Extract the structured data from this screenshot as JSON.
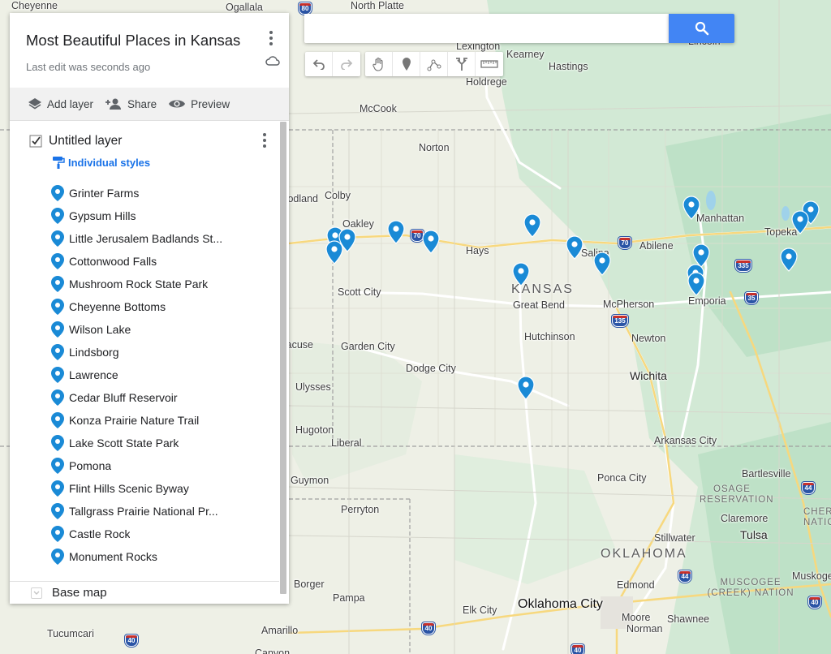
{
  "map_name": "Most Beautiful Places in Kansas",
  "edit_status": "Last edit was seconds ago",
  "actions": {
    "add_layer": "Add layer",
    "share": "Share",
    "preview": "Preview"
  },
  "layer": {
    "name": "Untitled layer",
    "checked": true,
    "style_label": "Individual styles",
    "places": [
      "Grinter Farms",
      "Gypsum Hills",
      "Little Jerusalem Badlands St...",
      "Cottonwood Falls",
      "Mushroom Rock State Park",
      "Cheyenne Bottoms",
      "Wilson Lake",
      "Lindsborg",
      "Lawrence",
      "Cedar Bluff Reservoir",
      "Konza Prairie Nature Trail",
      "Lake Scott State Park",
      "Pomona",
      "Flint Hills Scenic Byway",
      "Tallgrass Prairie National Pr...",
      "Castle Rock",
      "Monument Rocks"
    ]
  },
  "base_map_label": "Base map",
  "search": {
    "value": "",
    "placeholder": ""
  },
  "toolbar_icons": [
    "undo-icon",
    "redo-icon",
    "hand-icon",
    "marker-icon",
    "line-icon",
    "directions-icon",
    "ruler-icon"
  ],
  "colors": {
    "pin": "#1a8ad6",
    "accent": "#4285f4",
    "link": "#1a73e8"
  },
  "map_labels": {
    "cities": [
      "Cheyenne",
      "Ogallala",
      "North Platte",
      "Lexington",
      "Kearney",
      "Hastings",
      "Holdrege",
      "Lincoln",
      "McCook",
      "Norton",
      "Colby",
      "Oakley",
      "Hays",
      "Salina",
      "Abilene",
      "Manhattan",
      "Topeka",
      "Scott City",
      "Great Bend",
      "McPherson",
      "Emporia",
      "Garden City",
      "Hutchinson",
      "Newton",
      "Dodge City",
      "Wichita",
      "Ulysses",
      "Hugoton",
      "Liberal",
      "Arkansas City",
      "Guymon",
      "Ponca City",
      "Bartlesville",
      "Perryton",
      "Stillwater",
      "Claremore",
      "Tulsa",
      "Muskogee",
      "Edmond",
      "Borger",
      "Pampa",
      "Elk City",
      "Oklahoma City",
      "Moore",
      "Norman",
      "Shawnee",
      "Tucumcari",
      "Amarillo",
      "Canyon",
      "Goodland",
      "Syracuse"
    ],
    "states": [
      "KANSAS",
      "OKLAHOMA"
    ],
    "regions": [
      "OSAGE RESERVATION",
      "MUSCOGEE (CREEK) NATION",
      "CHEROKEE NATION"
    ],
    "highways": [
      "80",
      "70",
      "70",
      "335",
      "35",
      "135",
      "44",
      "40",
      "40",
      "40",
      "44",
      "40",
      "35"
    ]
  }
}
